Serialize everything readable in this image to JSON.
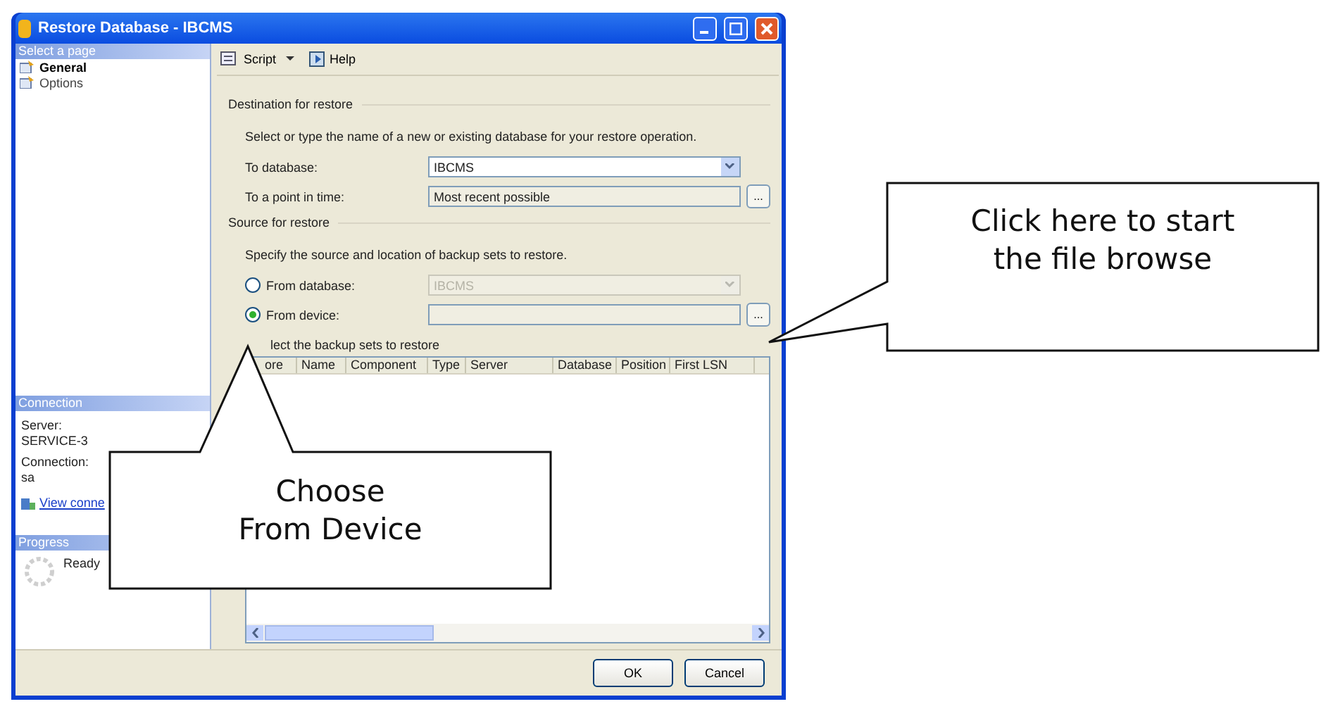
{
  "window": {
    "title": "Restore Database - IBCMS"
  },
  "sidebar": {
    "header": "Select a page",
    "pages": [
      {
        "label": "General",
        "selected": true
      },
      {
        "label": "Options",
        "selected": false
      }
    ]
  },
  "connection": {
    "header": "Connection",
    "server_label": "Server:",
    "server": "SERVICE-3",
    "connection_label": "Connection:",
    "user": "sa",
    "link": "View conne"
  },
  "progress": {
    "header": "Progress",
    "status": "Ready"
  },
  "toolbar": [
    {
      "label": "Script",
      "kind": "dropdown"
    },
    {
      "label": "Help",
      "kind": "button"
    }
  ],
  "destination": {
    "title": "Destination for restore",
    "description": "Select or type the name of a new or existing database for your restore operation.",
    "fields": [
      {
        "label": "To database:",
        "value": "IBCMS",
        "kind": "combo"
      },
      {
        "label": "To a point in time:",
        "value": "Most recent possible",
        "kind": "browse",
        "button": "..."
      }
    ]
  },
  "source": {
    "title": "Source for restore",
    "description": "Specify the source and location of backup sets to restore.",
    "options": [
      {
        "label": "From database:",
        "value": "IBCMS",
        "selected": false,
        "kind": "combo"
      },
      {
        "label": "From device:",
        "selected": true,
        "kind": "browse",
        "button": "..."
      }
    ]
  },
  "backup_sets": {
    "caption": "lect the backup sets to restore",
    "columns": [
      "ore",
      "Name",
      "Component",
      "Type",
      "Server",
      "Database",
      "Position",
      "First LSN"
    ]
  },
  "buttons": [
    "OK",
    "Cancel"
  ],
  "callouts": [
    {
      "text": "Choose\nFrom Device"
    },
    {
      "text": "Click here to start\nthe file browse"
    }
  ]
}
